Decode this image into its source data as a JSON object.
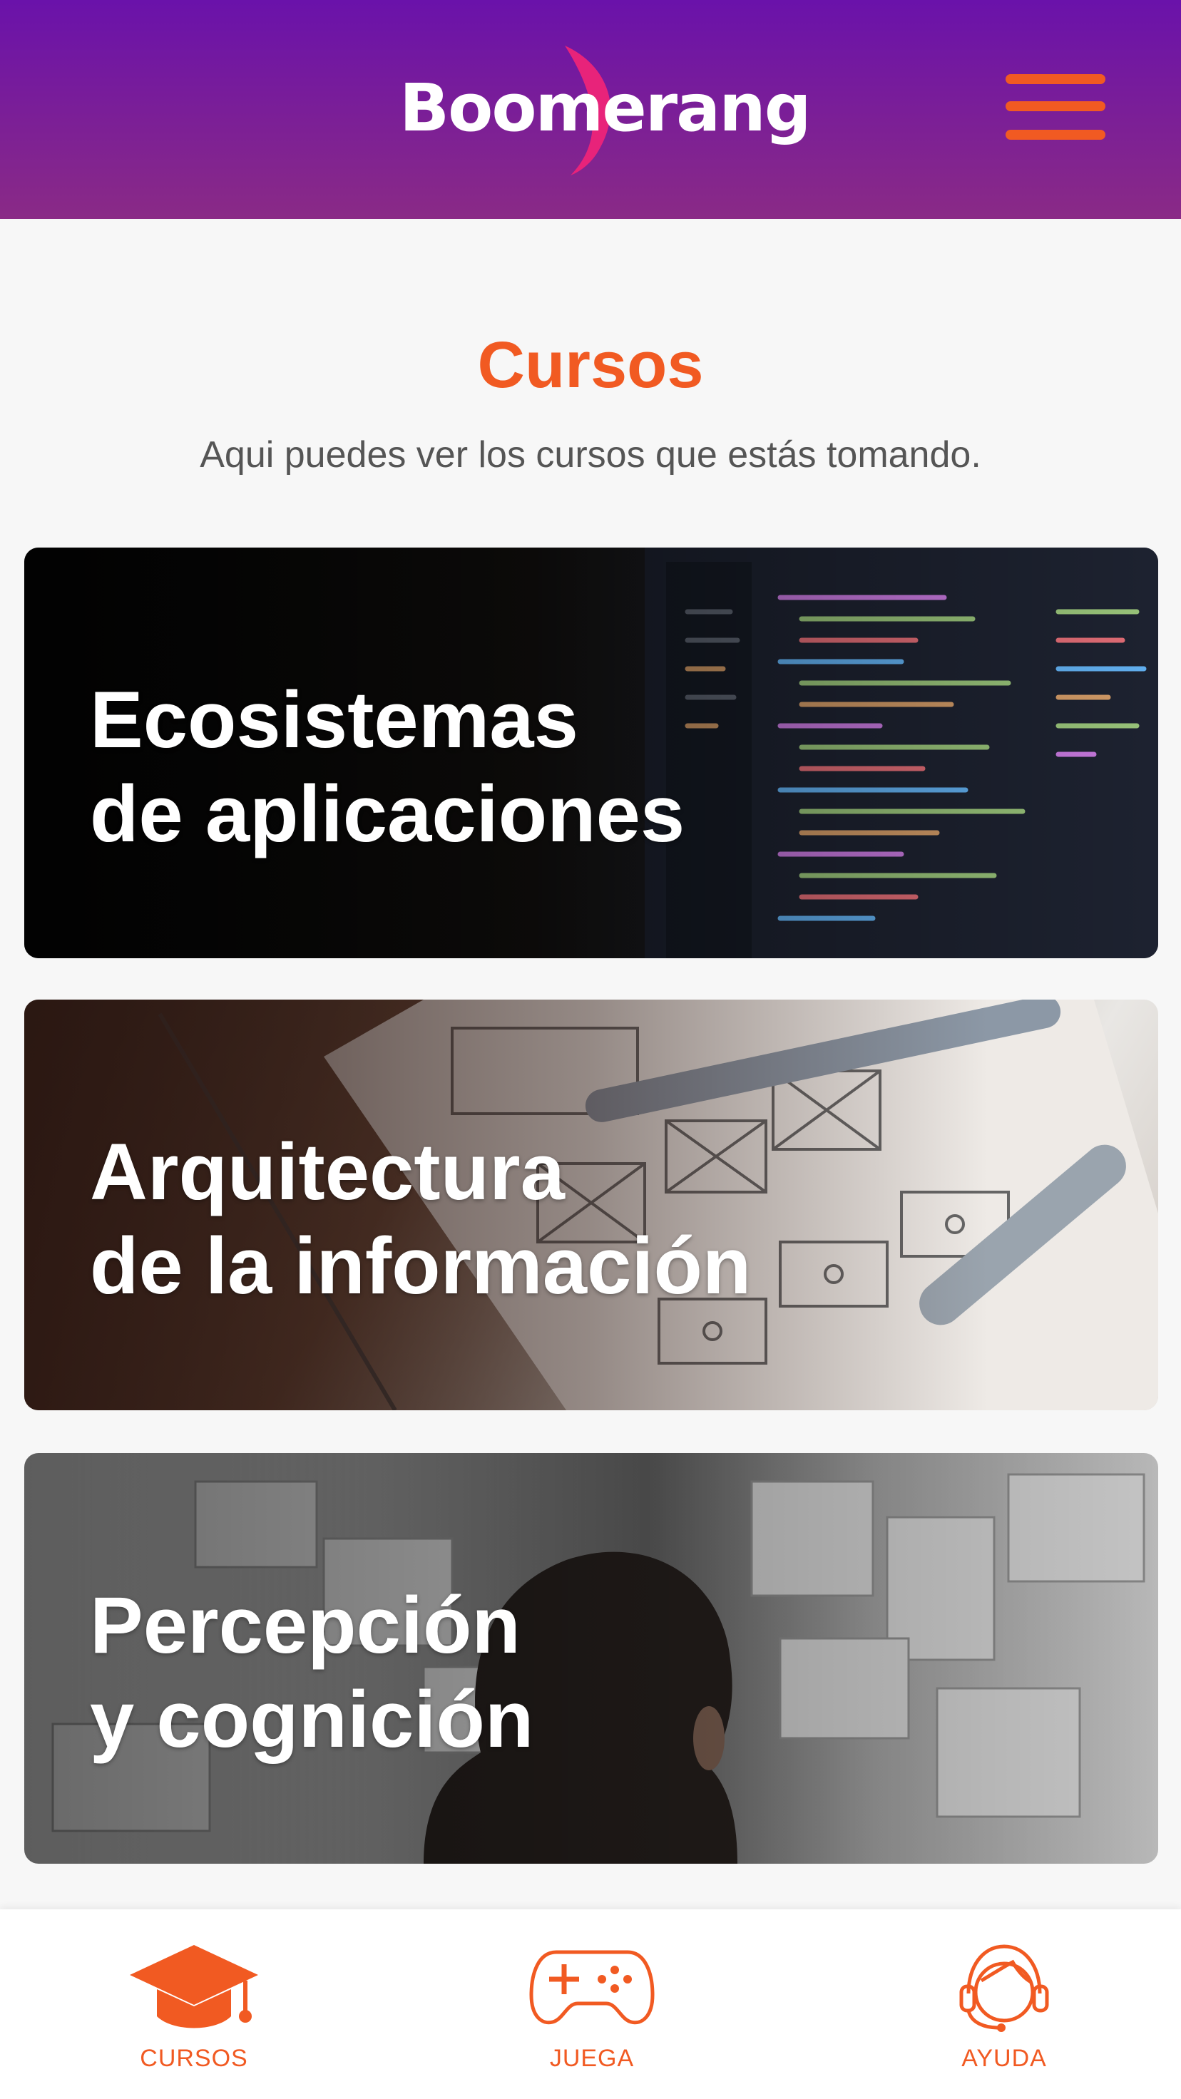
{
  "header": {
    "logo_text": "Boomerang",
    "menu_icon": "hamburger-menu-icon",
    "gradient_top": "#6a12aa",
    "gradient_bottom": "#8a2a86"
  },
  "main": {
    "title": "Cursos",
    "subtitle": "Aqui puedes ver los cursos que estás tomando."
  },
  "courses": [
    {
      "line1": "Ecosistemas",
      "line2": "de aplicaciones",
      "image": "code-on-monitor-photo"
    },
    {
      "line1": "Arquitectura",
      "line2": "de la información",
      "image": "wireframe-sketch-photo"
    },
    {
      "line1": "Percepción",
      "line2": "y cognición",
      "image": "person-at-moodboard-photo"
    }
  ],
  "bottom_nav": [
    {
      "label": "CURSOS",
      "icon": "graduation-cap-icon",
      "active": true
    },
    {
      "label": "JUEGA",
      "icon": "gamepad-icon",
      "active": false
    },
    {
      "label": "AYUDA",
      "icon": "headset-support-icon",
      "active": false
    }
  ],
  "colors": {
    "accent": "#f15a22",
    "logo_swoosh": "#e8237a",
    "background": "#f7f7f7",
    "subtitle_text": "#555555"
  }
}
